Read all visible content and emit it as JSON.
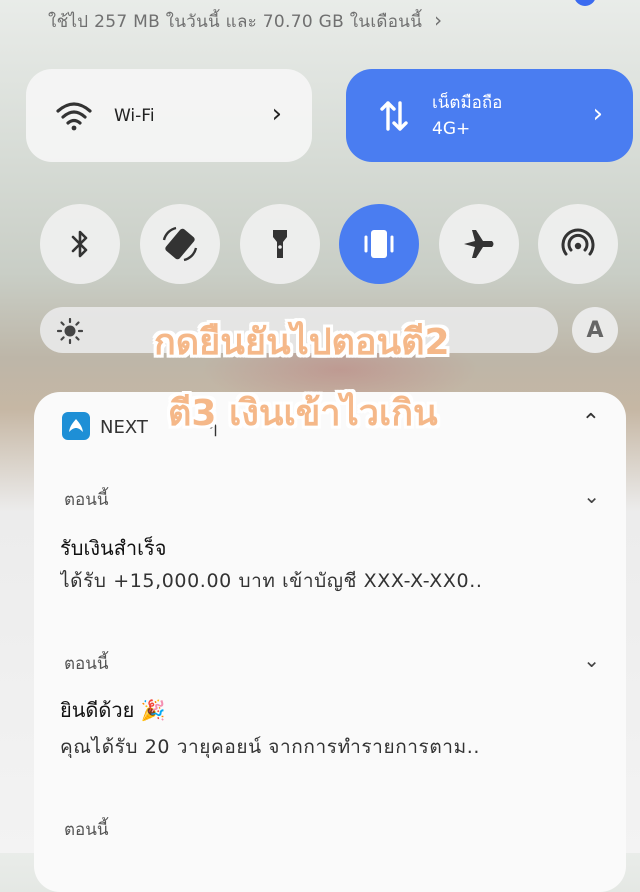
{
  "status": {
    "data_usage": "ใช้ไป 257 MB ในวันนี้ และ 70.70 GB ในเดือนนี้"
  },
  "tiles": {
    "wifi": {
      "label": "Wi-Fi",
      "icon": "wifi-icon"
    },
    "mobile": {
      "label": "เน็ตมือถือ",
      "sublabel": "4G+",
      "icon": "mobile-data-icon"
    }
  },
  "toggles": [
    {
      "icon": "bluetooth-icon",
      "active": false
    },
    {
      "icon": "auto-rotate-icon",
      "active": false
    },
    {
      "icon": "flashlight-icon",
      "active": false
    },
    {
      "icon": "vibrate-icon",
      "active": true
    },
    {
      "icon": "airplane-mode-icon",
      "active": false
    },
    {
      "icon": "hotspot-icon",
      "active": false
    }
  ],
  "brightness": {
    "icon": "sun-icon",
    "auto_label": "A"
  },
  "overlay": {
    "line1": "กดยืนยันไปตอนตี2",
    "line2": "ตี3 เงินเข้าไวเกิน"
  },
  "notification_group": {
    "app_name": "NEXT",
    "app_fragment": "ๆ",
    "items": [
      {
        "time": "ตอนนี้",
        "title": "รับเงินสำเร็จ",
        "body": "ได้รับ +15,000.00 บาท เข้าบัญชี XXX-X-XX0.."
      },
      {
        "time": "ตอนนี้",
        "title": "ยินดีด้วย 🎉",
        "body": "คุณได้รับ 20 วายุคอยน์ จากการทำรายการตาม.."
      },
      {
        "time": "ตอนนี้",
        "title": "",
        "body": ""
      }
    ]
  },
  "colors": {
    "accent": "#4a7df1",
    "overlay_text": "#f5b889"
  }
}
